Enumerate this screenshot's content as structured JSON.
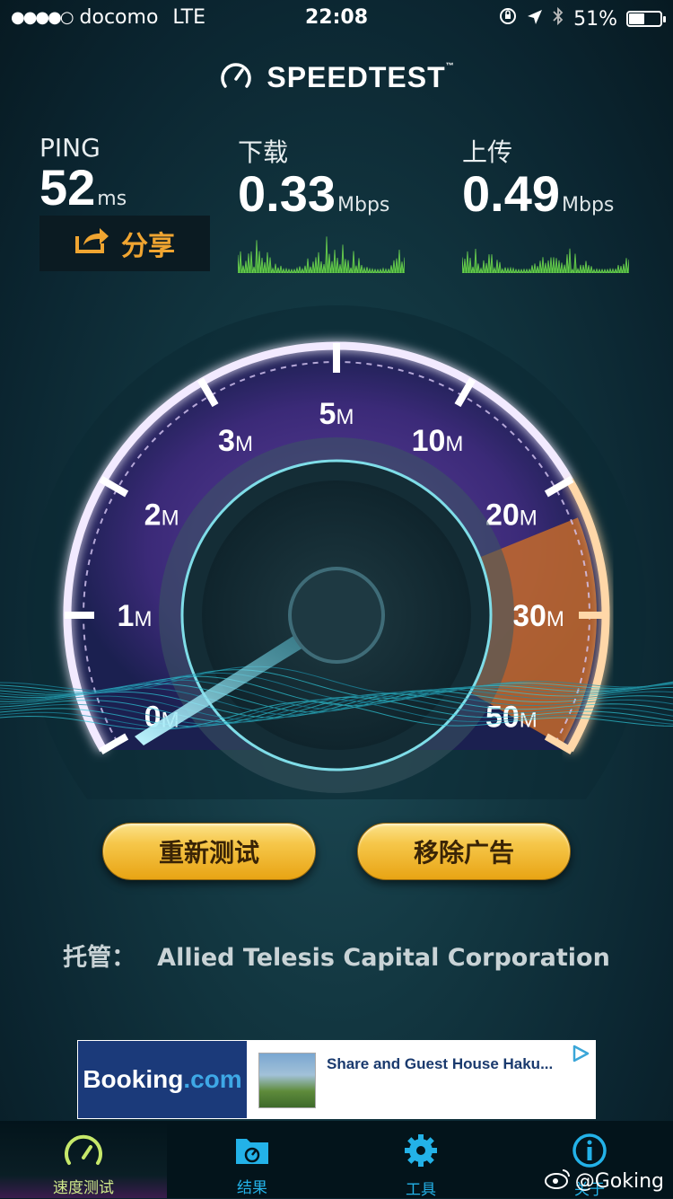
{
  "status_bar": {
    "signal": "●●●●○",
    "carrier": "docomo",
    "network": "LTE",
    "time": "22:08",
    "battery_percent": "51%",
    "battery_level": 0.51
  },
  "app": {
    "logo_text": "SPEEDTEST",
    "trademark": "™"
  },
  "metrics": {
    "ping": {
      "label": "PING",
      "value": "52",
      "unit": "ms"
    },
    "download": {
      "label": "下载",
      "value": "0.33",
      "unit": "Mbps"
    },
    "upload": {
      "label": "上传",
      "value": "0.49",
      "unit": "Mbps"
    }
  },
  "share_label": "分享",
  "gauge": {
    "ticks": [
      {
        "num": "0",
        "unit": "M"
      },
      {
        "num": "1",
        "unit": "M"
      },
      {
        "num": "2",
        "unit": "M"
      },
      {
        "num": "3",
        "unit": "M"
      },
      {
        "num": "5",
        "unit": "M"
      },
      {
        "num": "10",
        "unit": "M"
      },
      {
        "num": "20",
        "unit": "M"
      },
      {
        "num": "30",
        "unit": "M"
      },
      {
        "num": "50",
        "unit": "M"
      }
    ],
    "colors": {
      "arc": "#b58cf2",
      "upload_arc": "#f39a3b",
      "needle": "#6fe4f5"
    }
  },
  "buttons": {
    "retest": "重新测试",
    "remove_ads": "移除广告"
  },
  "host": {
    "label": "托管：",
    "name": "Allied Telesis Capital Corporation"
  },
  "ad": {
    "brand_main": "Booking",
    "brand_dot": ".com",
    "title": "Share and Guest House Haku..."
  },
  "tabs": [
    {
      "label": "速度测试",
      "icon": "speedometer-icon"
    },
    {
      "label": "结果",
      "icon": "folder-icon"
    },
    {
      "label": "工具",
      "icon": "gear-icon"
    },
    {
      "label": "关于",
      "icon": "info-icon"
    }
  ],
  "watermark": "@Goking"
}
